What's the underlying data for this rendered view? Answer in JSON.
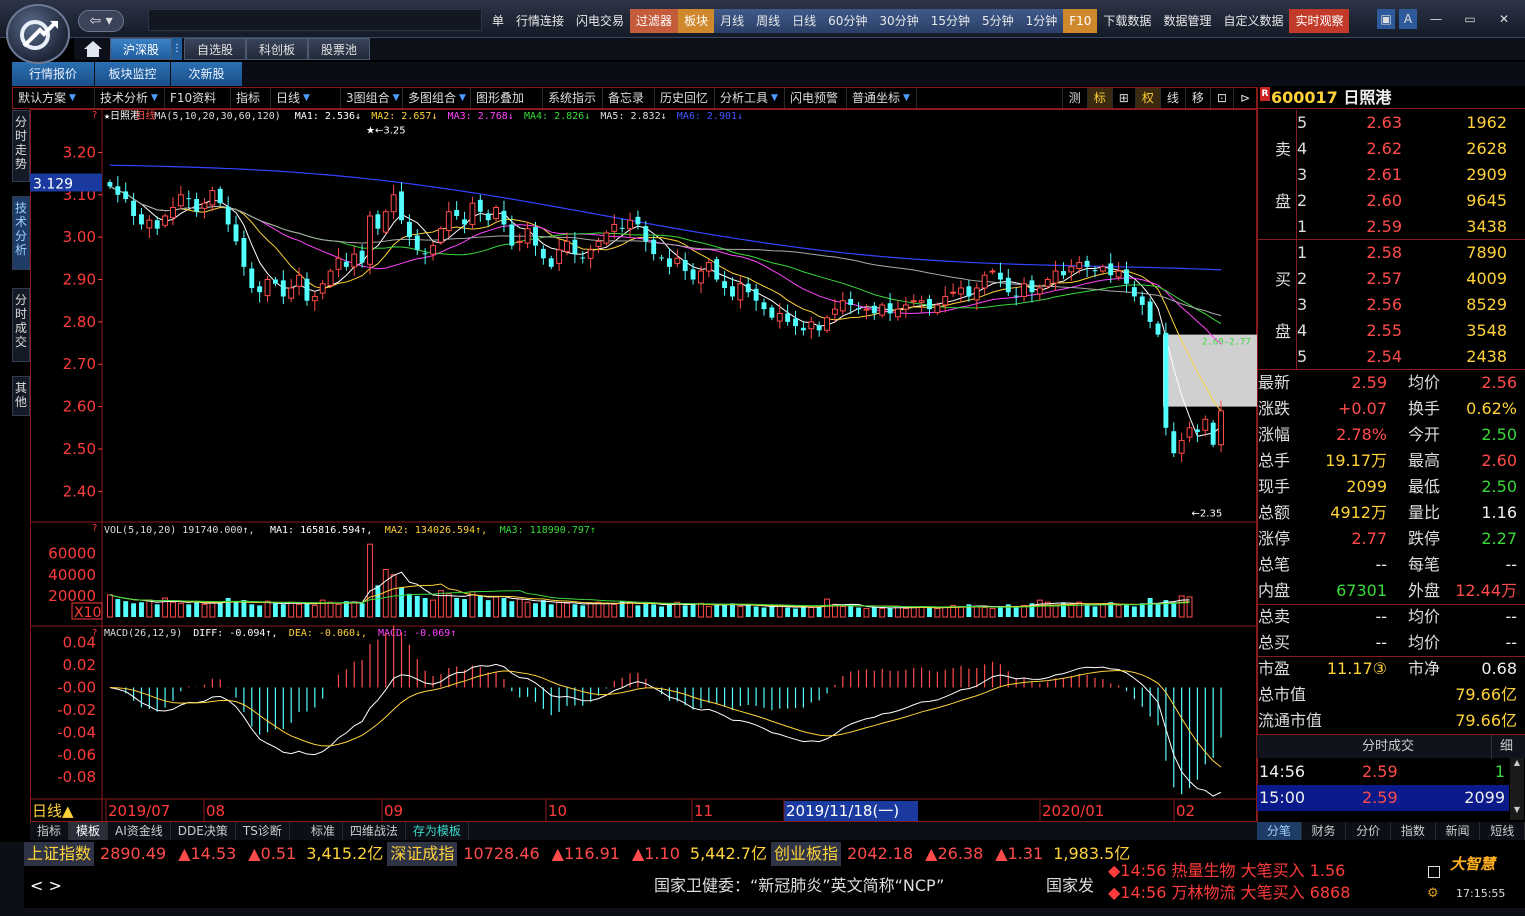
{
  "menu": {
    "items": [
      {
        "label": "单",
        "style": ""
      },
      {
        "label": "行情连接",
        "style": ""
      },
      {
        "label": "闪电交易",
        "style": ""
      },
      {
        "label": "过滤器",
        "style": "hl"
      },
      {
        "label": "板块",
        "style": "orange"
      },
      {
        "label": "月线",
        "style": "blue"
      },
      {
        "label": "周线",
        "style": "blue"
      },
      {
        "label": "日线",
        "style": "blue"
      },
      {
        "label": "60分钟",
        "style": "blue"
      },
      {
        "label": "30分钟",
        "style": "blue"
      },
      {
        "label": "15分钟",
        "style": "blue"
      },
      {
        "label": "5分钟",
        "style": "blue"
      },
      {
        "label": "1分钟",
        "style": "blue"
      },
      {
        "label": "F10",
        "style": "orange"
      },
      {
        "label": "下载数据",
        "style": ""
      },
      {
        "label": "数据管理",
        "style": ""
      },
      {
        "label": "自定义数据",
        "style": ""
      },
      {
        "label": "实时观察",
        "style": "red"
      }
    ],
    "back_label": "⇦ ▾"
  },
  "market_tabs": [
    "沪深股",
    "自选股",
    "科创板",
    "股票池"
  ],
  "sub_tabs": [
    "行情报价",
    "板块监控",
    "次新股"
  ],
  "toolbar": {
    "left": [
      {
        "label": "默认方案",
        "arrow": true
      },
      {
        "label": "技术分析",
        "arrow": true
      },
      {
        "label": "F10资料",
        "arrow": false
      },
      {
        "label": "指标",
        "arrow": false
      },
      {
        "label": "日线",
        "arrow": true
      },
      {
        "label": "3图组合",
        "arrow": true
      },
      {
        "label": "多图组合",
        "arrow": true
      },
      {
        "label": "图形叠加",
        "arrow": false
      },
      {
        "label": "系统指示",
        "arrow": false
      },
      {
        "label": "备忘录",
        "arrow": false
      },
      {
        "label": "历史回忆",
        "arrow": false
      },
      {
        "label": "分析工具",
        "arrow": true
      },
      {
        "label": "闪电预警",
        "arrow": false
      },
      {
        "label": "普通坐标",
        "arrow": true
      }
    ],
    "right": [
      "测",
      "标",
      "⊞",
      "权",
      "线",
      "移",
      "⊡",
      "⊳"
    ]
  },
  "vtabs": [
    "分时走势",
    "技术分析",
    "分时成交",
    "其他"
  ],
  "stock": {
    "code": "600017",
    "name": "日照港",
    "badge": "R"
  },
  "chart_data": {
    "type": "candlestick",
    "title": "日照港",
    "period": "日线",
    "ma_legend": [
      {
        "text": "★日照港",
        "color": "#ffffff"
      },
      {
        "text": "日线",
        "color": "#ff4b4b"
      },
      {
        "text": "MA(5,10,20,30,60,120)",
        "color": "#dddddd"
      },
      {
        "text": "MA1: 2.536↓",
        "color": "#ffffff"
      },
      {
        "text": "MA2: 2.657↓",
        "color": "#ffd23a"
      },
      {
        "text": "MA3: 2.768↓",
        "color": "#ff44ff"
      },
      {
        "text": "MA4: 2.826↓",
        "color": "#3ad83a"
      },
      {
        "text": "MA5: 2.832↓",
        "color": "#dddddd"
      },
      {
        "text": "MA6: 2.901↓",
        "color": "#4455ff"
      }
    ],
    "price_axis": [
      "3.20",
      "3.10",
      "3.00",
      "2.90",
      "2.80",
      "2.70",
      "2.60",
      "2.50",
      "2.40"
    ],
    "ylim": [
      2.33,
      3.26
    ],
    "cursor_price": "3.129",
    "high_label": "3.25",
    "low_label": "2.35",
    "range_label": "2.60-2.77",
    "closes": [
      3.12,
      3.1,
      3.09,
      3.05,
      3.03,
      3.04,
      3.02,
      3.05,
      3.07,
      3.1,
      3.09,
      3.06,
      3.08,
      3.11,
      3.08,
      3.03,
      2.99,
      2.93,
      2.88,
      2.87,
      2.9,
      2.89,
      2.86,
      2.88,
      2.91,
      2.85,
      2.86,
      2.89,
      2.92,
      2.95,
      2.93,
      2.96,
      2.94,
      3.05,
      3.02,
      3.06,
      3.1,
      3.04,
      3.0,
      2.97,
      2.96,
      2.98,
      3.02,
      3.06,
      3.05,
      3.03,
      3.08,
      3.06,
      3.04,
      3.07,
      3.03,
      2.98,
      2.99,
      3.02,
      2.98,
      2.95,
      2.93,
      2.97,
      2.99,
      2.96,
      2.95,
      2.97,
      2.99,
      3.01,
      3.03,
      3.02,
      3.04,
      3.03,
      2.99,
      2.96,
      2.95,
      2.93,
      2.95,
      2.92,
      2.9,
      2.92,
      2.94,
      2.9,
      2.88,
      2.86,
      2.89,
      2.87,
      2.85,
      2.83,
      2.81,
      2.82,
      2.8,
      2.79,
      2.78,
      2.8,
      2.78,
      2.81,
      2.83,
      2.85,
      2.84,
      2.83,
      2.83,
      2.82,
      2.84,
      2.82,
      2.83,
      2.84,
      2.85,
      2.85,
      2.83,
      2.84,
      2.86,
      2.87,
      2.88,
      2.86,
      2.88,
      2.91,
      2.92,
      2.9,
      2.87,
      2.86,
      2.89,
      2.87,
      2.88,
      2.9,
      2.92,
      2.91,
      2.93,
      2.94,
      2.93,
      2.92,
      2.93,
      2.91,
      2.92,
      2.89,
      2.86,
      2.84,
      2.8,
      2.77,
      2.55,
      2.49,
      2.52,
      2.55,
      2.54,
      2.57,
      2.51,
      2.59
    ],
    "volume_axis": [
      "60000",
      "40000",
      "20000"
    ],
    "volume_legend": [
      {
        "text": "VOL(5,10,20) 191740.000↑,",
        "color": "#dddddd"
      },
      {
        "text": "MA1: 165816.594↑,",
        "color": "#ffffff"
      },
      {
        "text": "MA2: 134026.594↑,",
        "color": "#ffd23a"
      },
      {
        "text": "MA3: 118990.797↑",
        "color": "#3ad83a"
      }
    ],
    "volume_multiplier": "X10",
    "volumes": [
      21000,
      17000,
      15000,
      13000,
      14000,
      16000,
      12000,
      18000,
      14000,
      13000,
      12000,
      15000,
      12000,
      14000,
      13000,
      18000,
      14000,
      16000,
      12000,
      11000,
      15000,
      13000,
      12000,
      14000,
      12000,
      13000,
      11000,
      16000,
      14000,
      12000,
      15000,
      14000,
      13000,
      69000,
      30000,
      45000,
      40000,
      28000,
      22000,
      20000,
      18000,
      16000,
      25000,
      22000,
      18000,
      17000,
      24000,
      20000,
      16000,
      19000,
      18000,
      15000,
      17000,
      14000,
      13000,
      16000,
      12000,
      14000,
      13000,
      12000,
      11000,
      13000,
      14000,
      13000,
      12000,
      15000,
      14000,
      11000,
      13000,
      12000,
      10000,
      12000,
      14000,
      11000,
      12000,
      13000,
      10000,
      11000,
      12000,
      13000,
      10000,
      11000,
      10000,
      9000,
      10000,
      11000,
      9000,
      8000,
      10000,
      9000,
      10000,
      17000,
      12000,
      10000,
      11000,
      9000,
      8000,
      9000,
      8000,
      9000,
      10000,
      8000,
      9000,
      10000,
      9000,
      8000,
      9000,
      11000,
      10000,
      12000,
      10000,
      9000,
      8000,
      10000,
      12000,
      9000,
      11000,
      13000,
      16000,
      14000,
      11000,
      13000,
      12000,
      14000,
      12000,
      10000,
      12000,
      14000,
      11000,
      12000,
      10000,
      13000,
      18000,
      12000,
      16000,
      14000,
      20000,
      19000
    ],
    "macd_axis": [
      "0.04",
      "0.02",
      "-0.00",
      "-0.02",
      "-0.04",
      "-0.06",
      "-0.08"
    ],
    "macd_legend": [
      {
        "text": "MACD(26,12,9)",
        "color": "#dddddd"
      },
      {
        "text": "DIFF: -0.094↑,",
        "color": "#ffffff"
      },
      {
        "text": "DEA: -0.060↓,",
        "color": "#ffd23a"
      },
      {
        "text": "MACD: -0.069↑",
        "color": "#ff44ff"
      }
    ],
    "macd_ylim": [
      -0.095,
      0.045
    ],
    "x_labels": [
      "2019/07",
      "08",
      "09",
      "10",
      "11",
      "2019/11/18(一)",
      "2020/01",
      "02"
    ],
    "x_label_status": "日线▲"
  },
  "orderbook": {
    "side_sell": [
      "卖",
      "盘"
    ],
    "side_buy": [
      "买",
      "盘"
    ],
    "sell": [
      {
        "lvl": "5",
        "price": "2.63",
        "vol": "1962"
      },
      {
        "lvl": "4",
        "price": "2.62",
        "vol": "2628"
      },
      {
        "lvl": "3",
        "price": "2.61",
        "vol": "2909"
      },
      {
        "lvl": "2",
        "price": "2.60",
        "vol": "9645"
      },
      {
        "lvl": "1",
        "price": "2.59",
        "vol": "3438"
      }
    ],
    "buy": [
      {
        "lvl": "1",
        "price": "2.58",
        "vol": "7890"
      },
      {
        "lvl": "2",
        "price": "2.57",
        "vol": "4009"
      },
      {
        "lvl": "3",
        "price": "2.56",
        "vol": "8529"
      },
      {
        "lvl": "4",
        "price": "2.55",
        "vol": "3548"
      },
      {
        "lvl": "5",
        "price": "2.54",
        "vol": "2438"
      }
    ]
  },
  "quotes": [
    {
      "k1": "最新",
      "v1": "2.59",
      "c1": "red",
      "k2": "均价",
      "v2": "2.56",
      "c2": "red"
    },
    {
      "k1": "涨跌",
      "v1": "+0.07",
      "c1": "red",
      "k2": "换手",
      "v2": "0.62%",
      "c2": "yellow"
    },
    {
      "k1": "涨幅",
      "v1": "2.78%",
      "c1": "red",
      "k2": "今开",
      "v2": "2.50",
      "c2": "green"
    },
    {
      "k1": "总手",
      "v1": "19.17万",
      "c1": "yellow",
      "k2": "最高",
      "v2": "2.60",
      "c2": "red"
    },
    {
      "k1": "现手",
      "v1": "2099",
      "c1": "yellow",
      "k2": "最低",
      "v2": "2.50",
      "c2": "green"
    },
    {
      "k1": "总额",
      "v1": "4912万",
      "c1": "yellow",
      "k2": "量比",
      "v2": "1.16",
      "c2": "white"
    },
    {
      "k1": "涨停",
      "v1": "2.77",
      "c1": "red",
      "k2": "跌停",
      "v2": "2.27",
      "c2": "green"
    },
    {
      "k1": "总笔",
      "v1": "--",
      "c1": "white",
      "k2": "每笔",
      "v2": "--",
      "c2": "white"
    },
    {
      "k1": "内盘",
      "v1": "67301",
      "c1": "green",
      "k2": "外盘",
      "v2": "12.44万",
      "c2": "red"
    },
    {
      "k1": "总卖",
      "v1": "--",
      "c1": "white",
      "k2": "均价",
      "v2": "--",
      "c2": "white"
    },
    {
      "k1": "总买",
      "v1": "--",
      "c1": "white",
      "k2": "均价",
      "v2": "--",
      "c2": "white"
    },
    {
      "k1": "市盈",
      "v1": "11.17③",
      "c1": "yellow",
      "k2": "市净",
      "v2": "0.68",
      "c2": "white"
    }
  ],
  "quotes_wide": [
    {
      "k": "总市值",
      "v": "79.66亿"
    },
    {
      "k": "流通市值",
      "v": "79.66亿"
    }
  ],
  "ticks": {
    "title": "分时成交",
    "detail": "细",
    "rows": [
      {
        "time": "14:56",
        "price": "2.59",
        "vol": "1"
      },
      {
        "time": "15:00",
        "price": "2.59",
        "vol": "2099"
      }
    ]
  },
  "right_tabs": [
    "分笔",
    "财务",
    "分价",
    "指数",
    "新闻",
    "短线"
  ],
  "bottom_tabs": [
    "指标",
    "模板",
    "AI资金线",
    "DDE决策",
    "TS诊断",
    "标准",
    "四维战法",
    "存为模板"
  ],
  "index_bar": [
    {
      "name": "上证指数",
      "val": "2890.49",
      "chg": "▲14.53",
      "pct": "▲0.51",
      "amt": "3,415.2亿"
    },
    {
      "name": "深证成指",
      "val": "10728.46",
      "chg": "▲116.91",
      "pct": "▲1.10",
      "amt": "5,442.7亿"
    },
    {
      "name": "创业板指",
      "val": "2042.18",
      "chg": "▲26.38",
      "pct": "▲1.31",
      "amt": "1,983.5亿"
    }
  ],
  "news": {
    "nav": "< >",
    "text": "国家卫健委：“新冠肺炎”英文简称“NCP”",
    "trail": "国家发"
  },
  "alerts": [
    "◆14:56 热量生物 大笔买入 1.56",
    "◆14:56 万林物流 大笔买入 6868"
  ],
  "brand": {
    "name": "大智慧",
    "time": "17:15:55"
  }
}
